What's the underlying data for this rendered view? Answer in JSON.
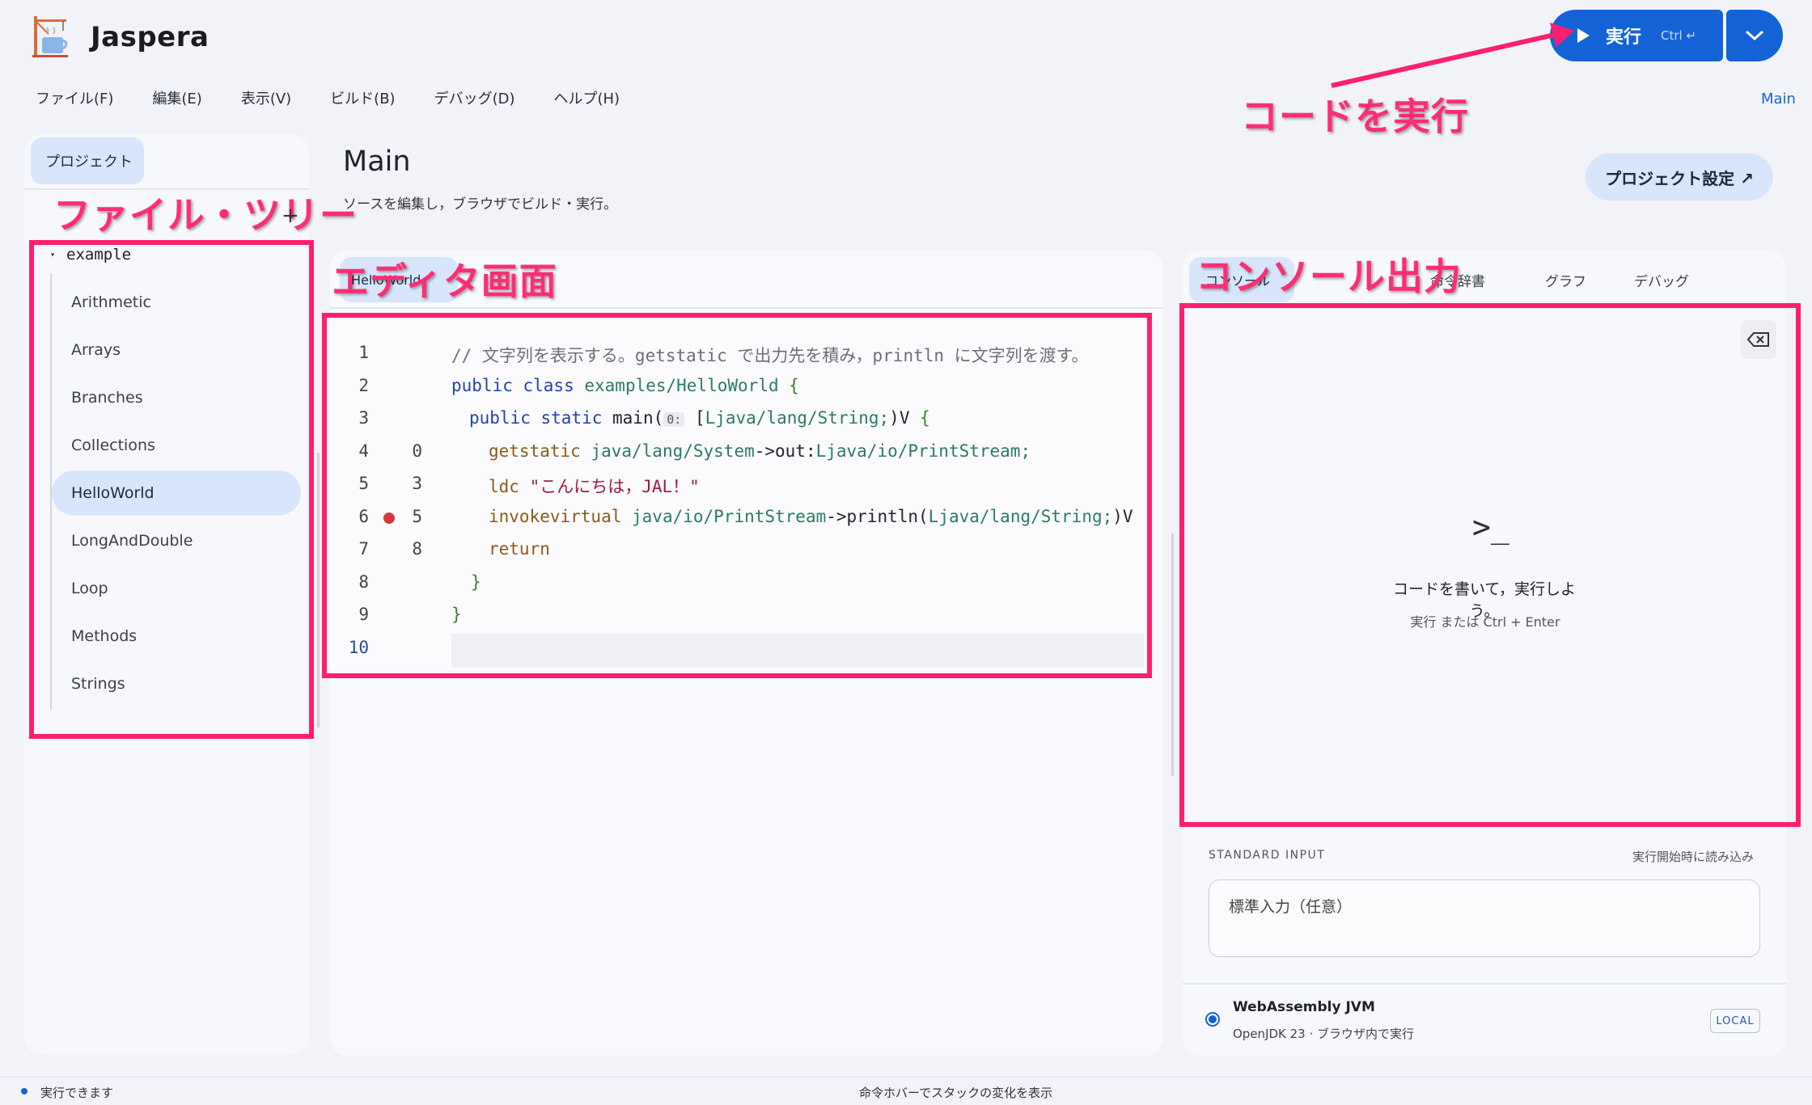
{
  "app": {
    "title": "Jaspera"
  },
  "menu": [
    "ファイル(F)",
    "編集(E)",
    "表示(V)",
    "ビルド(B)",
    "デバッグ(D)",
    "ヘルプ(H)"
  ],
  "toolbar": {
    "run_label": "実行",
    "run_shortcut": "Ctrl ↵",
    "main_link": "Main"
  },
  "annotations": {
    "run": "コードを実行",
    "file_tree": "ファイル・ツリー",
    "editor": "エディタ画面",
    "console": "コンソール出力"
  },
  "sidebar": {
    "tab": "プロジェクト",
    "add": "+",
    "root": "example",
    "items": [
      "Arithmetic",
      "Arrays",
      "Branches",
      "Collections",
      "HelloWorld",
      "LongAndDouble",
      "Loop",
      "Methods",
      "Strings"
    ],
    "selected": "HelloWorld"
  },
  "main": {
    "title": "Main",
    "subtitle": "ソースを編集し，ブラウザでビルド・実行。",
    "project_settings": "プロジェクト設定 ↗",
    "editor_tab": "HelloWorld"
  },
  "editor": {
    "lines": [
      {
        "n": "1",
        "offset": "",
        "bp": false,
        "text": "// 文字列を表示する。getstatic で出力先を積み，println に文字列を渡す。"
      },
      {
        "n": "2",
        "offset": "",
        "bp": false,
        "text": "public class examples/HelloWorld {"
      },
      {
        "n": "3",
        "offset": "",
        "bp": false,
        "text": "public static main(",
        "hint": "0:",
        "text2": " [Ljava/lang/String;)V {"
      },
      {
        "n": "4",
        "offset": "0",
        "bp": false,
        "text": "getstatic java/lang/System->out:Ljava/io/PrintStream;"
      },
      {
        "n": "5",
        "offset": "3",
        "bp": false,
        "text": "ldc \"こんにちは，JAL！\""
      },
      {
        "n": "6",
        "offset": "5",
        "bp": true,
        "text": "invokevirtual java/io/PrintStream->println(Ljava/lang/String;)V"
      },
      {
        "n": "7",
        "offset": "8",
        "bp": false,
        "text": "return"
      },
      {
        "n": "8",
        "offset": "",
        "bp": false,
        "text": "}"
      },
      {
        "n": "9",
        "offset": "",
        "bp": false,
        "text": "}"
      },
      {
        "n": "10",
        "offset": "",
        "bp": false,
        "text": ""
      }
    ]
  },
  "console": {
    "tabs": [
      "コンソール",
      "命令辞書",
      "グラフ",
      "デバッグ"
    ],
    "prompt": ">_",
    "empty_title": "コードを書いて，実行しよう。",
    "empty_sub": "実行 または Ctrl + Enter"
  },
  "stdin": {
    "label": "STANDARD INPUT",
    "hint": "実行開始時に読み込み",
    "placeholder": "標準入力（任意）"
  },
  "runtime": {
    "name": "WebAssembly JVM",
    "sub": "OpenJDK 23 · ブラウザ内で実行",
    "badge": "LOCAL"
  },
  "status": {
    "left": "実行できます",
    "center": "命令ホバーでスタックの変化を表示"
  },
  "colors": {
    "accent": "#1463d6",
    "annotation": "#ff1f6e",
    "selected": "#d8e6fb"
  }
}
